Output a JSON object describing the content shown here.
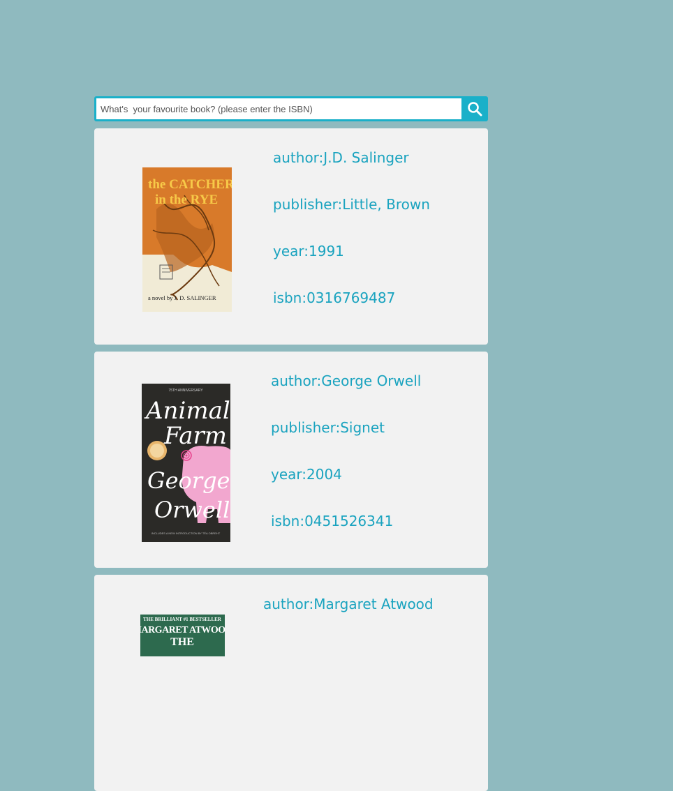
{
  "search": {
    "placeholder": "What's  your favourite book? (please enter the ISBN)",
    "icon": "search-icon"
  },
  "books": [
    {
      "author_label": "author:J.D. Salinger",
      "publisher_label": "publisher:Little, Brown",
      "year_label": "year:1991",
      "isbn_label": "isbn:0316769487",
      "cover": {
        "title_line1": "the CATCHER",
        "title_line2": "in the RYE",
        "byline": "a novel by J. D. SALINGER"
      }
    },
    {
      "author_label": "author:George Orwell",
      "publisher_label": "publisher:Signet",
      "year_label": "year:2004",
      "isbn_label": "isbn:0451526341",
      "cover": {
        "top_text": "75TH ANNIVERSARY",
        "title_line1": "Animal",
        "title_line2": "Farm",
        "author_line1": "George",
        "author_line2": "Orwell",
        "bottom_text": "INCLUDES A NEW INTRODUCTION BY TÉA OBREHT"
      }
    },
    {
      "author_label": "author:Margaret Atwood",
      "cover": {
        "top_text": "THE BRILLIANT #1 BESTSELLER",
        "author_text": "MARGARET ATWOOD",
        "title_text": "THE"
      }
    }
  ],
  "colors": {
    "background": "#8fbabf",
    "accent": "#1ab0c9",
    "info_text": "#1aa3bf",
    "card": "#f2f2f2"
  }
}
